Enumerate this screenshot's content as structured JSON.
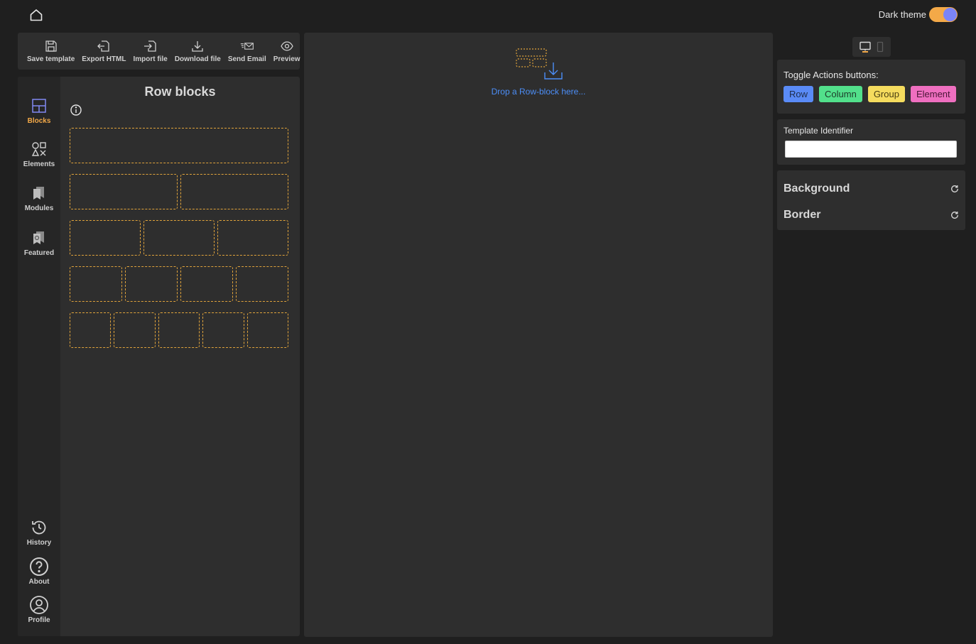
{
  "topbar": {
    "home_icon": "home-icon",
    "theme_label": "Dark theme",
    "theme_on": true
  },
  "toolbar": {
    "items": [
      {
        "label": "Save template",
        "icon": "save-icon"
      },
      {
        "label": "Export HTML",
        "icon": "export-icon"
      },
      {
        "label": "Import file",
        "icon": "import-icon"
      },
      {
        "label": "Download file",
        "icon": "download-icon"
      },
      {
        "label": "Send Email",
        "icon": "email-icon"
      },
      {
        "label": "Preview",
        "icon": "eye-icon"
      }
    ]
  },
  "sidebar": {
    "items": [
      {
        "label": "Blocks",
        "icon": "blocks-icon",
        "active": true
      },
      {
        "label": "Elements",
        "icon": "shapes-icon"
      },
      {
        "label": "Modules",
        "icon": "modules-icon"
      },
      {
        "label": "Featured",
        "icon": "featured-icon"
      }
    ],
    "bottom_items": [
      {
        "label": "History",
        "icon": "history-icon"
      },
      {
        "label": "About",
        "icon": "help-icon"
      },
      {
        "label": "Profile",
        "icon": "profile-icon"
      }
    ]
  },
  "blocks": {
    "title": "Row blocks",
    "column_counts": [
      1,
      2,
      3,
      4,
      5
    ]
  },
  "canvas": {
    "drop_text": "Drop a Row-block here..."
  },
  "right_panel": {
    "device_modes": [
      "desktop-icon",
      "mobile-icon"
    ],
    "actions_label": "Toggle Actions buttons:",
    "action_buttons": [
      {
        "label": "Row",
        "bg": "#5a8bf7",
        "fg": "#1d2b4a"
      },
      {
        "label": "Column",
        "bg": "#52e08b",
        "fg": "#1d3b29"
      },
      {
        "label": "Group",
        "bg": "#f5dc5e",
        "fg": "#4a3f12"
      },
      {
        "label": "Element",
        "bg": "#ef6fc0",
        "fg": "#4a1636"
      }
    ],
    "identifier_label": "Template Identifier",
    "identifier_value": "",
    "style_sections": [
      {
        "label": "Background",
        "icon": "reset-icon"
      },
      {
        "label": "Border",
        "icon": "reset-icon"
      }
    ]
  },
  "colors": {
    "accent_orange": "#f3a948",
    "accent_blue": "#4c8ef7",
    "accent_violet": "#7b84f7"
  }
}
